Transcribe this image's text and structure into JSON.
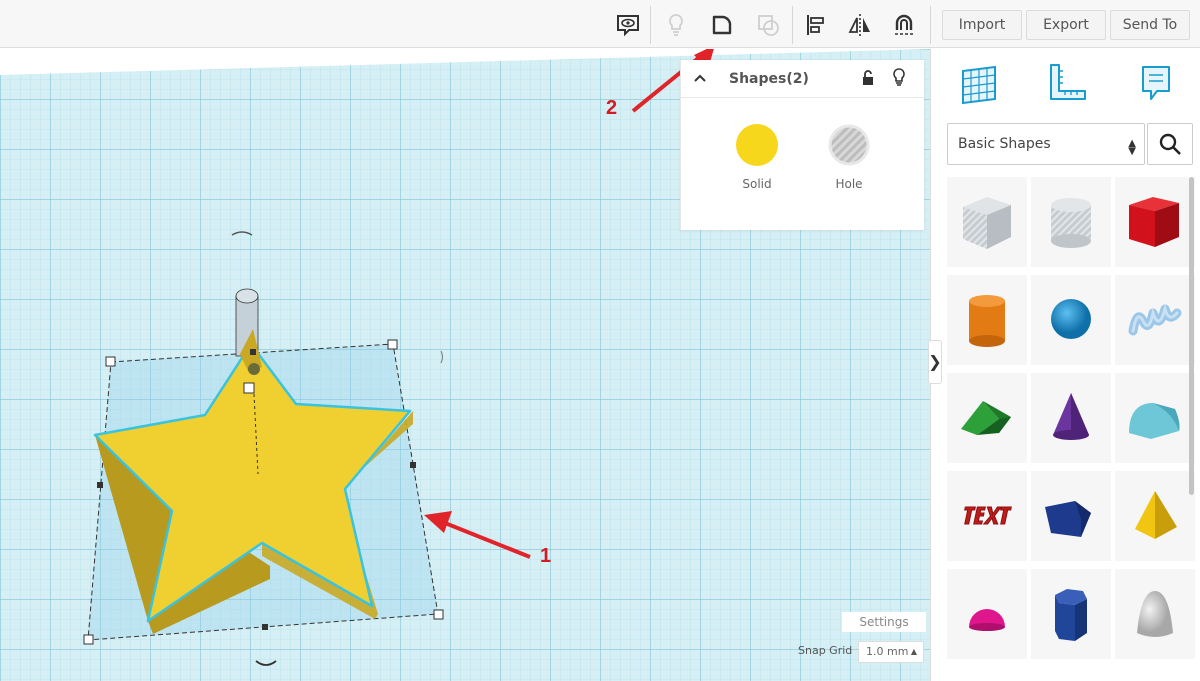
{
  "toolbar": {
    "tools": [
      {
        "name": "note-tool",
        "icon": "note-eye-icon"
      },
      {
        "name": "light-tool",
        "icon": "lightbulb-icon"
      },
      {
        "name": "group-tool",
        "icon": "group-icon"
      },
      {
        "name": "ungroup-tool",
        "icon": "ungroup-icon"
      },
      {
        "name": "align-tool",
        "icon": "align-icon"
      },
      {
        "name": "mirror-tool",
        "icon": "mirror-icon"
      },
      {
        "name": "cruise-tool",
        "icon": "cruise-magnet-icon"
      }
    ],
    "import_label": "Import",
    "export_label": "Export",
    "send_to_label": "Send To"
  },
  "shapes_panel": {
    "title": "Shapes(2)",
    "solid_label": "Solid",
    "hole_label": "Hole",
    "solid_color": "#f7d71c",
    "hole_color": "#c7c7c7"
  },
  "annotations": {
    "arrow_1": "1",
    "arrow_2": "2",
    "arrow_color": "#e0242a"
  },
  "workplane": {
    "settings_label": "Settings",
    "snap_grid_label": "Snap Grid",
    "snap_grid_value": "1.0 mm",
    "grid_color": "#8fd0df",
    "star_color": "#f0cf30"
  },
  "library": {
    "view_icons": [
      "workplane-grid-icon",
      "ruler-icon",
      "notes-icon"
    ],
    "category": "Basic Shapes",
    "shapes": [
      {
        "name": "box-hole",
        "color": "#c9cdd2"
      },
      {
        "name": "cylinder-hole",
        "color": "#c9cdd2"
      },
      {
        "name": "box",
        "color": "#d1111b"
      },
      {
        "name": "cylinder",
        "color": "#e27b14"
      },
      {
        "name": "sphere",
        "color": "#1a93d4"
      },
      {
        "name": "scribble",
        "color": "#9cc7e8"
      },
      {
        "name": "roof",
        "color": "#2ea03a"
      },
      {
        "name": "cone",
        "color": "#6b35a0"
      },
      {
        "name": "round-roof",
        "color": "#6ec7d6"
      },
      {
        "name": "text",
        "color": "#c01b1b"
      },
      {
        "name": "polygon",
        "color": "#1e3a8c"
      },
      {
        "name": "pyramid",
        "color": "#f0c613"
      },
      {
        "name": "half-sphere",
        "color": "#e0168c"
      },
      {
        "name": "hexagonal-prism",
        "color": "#20469a"
      },
      {
        "name": "paraboloid",
        "color": "#d6d6d6"
      }
    ]
  }
}
